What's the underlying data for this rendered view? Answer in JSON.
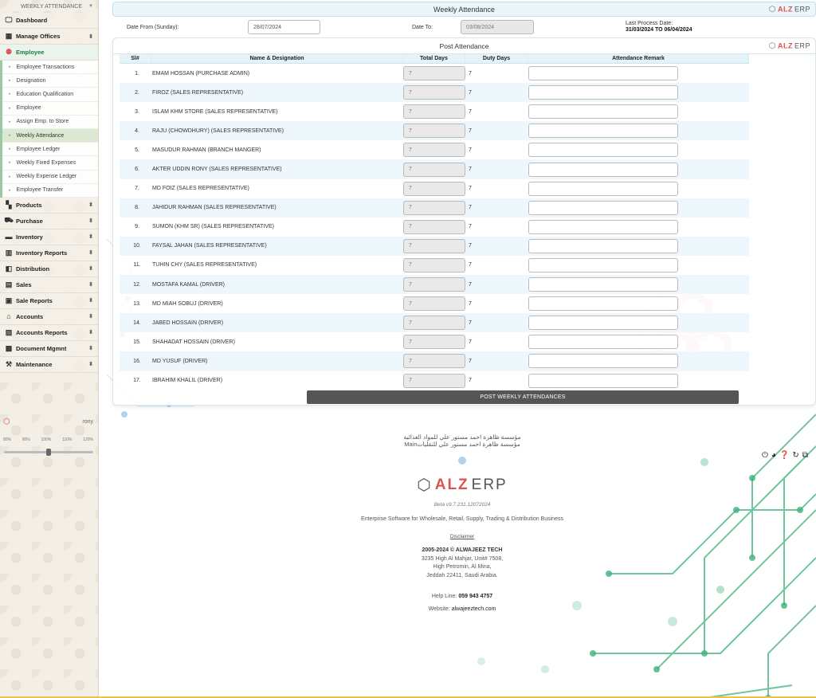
{
  "sidebar": {
    "module_label": "WEEKLY ATTENDANCE",
    "items": [
      {
        "label": "Dashboard",
        "icon": "monitor-icon",
        "glyph": "▭",
        "arrow": ""
      },
      {
        "label": "Manage Offices",
        "icon": "office-icon",
        "glyph": "▦",
        "arrow": "⬍"
      },
      {
        "label": "Employee",
        "icon": "users-icon",
        "glyph": "👥",
        "arrow": ""
      }
    ],
    "employee_sub": [
      "Employee Transactions",
      "Designation",
      "Education Qualification",
      "Employee",
      "Assign Emp. to Store",
      "Weekly Attendance",
      "Employee Ledger",
      "Weekly Fixed Expenses",
      "Weekly Expense Ledger",
      "Employee Transfer"
    ],
    "items_after": [
      {
        "label": "Products",
        "icon": "grid-icon",
        "glyph": "▚"
      },
      {
        "label": "Purchase",
        "icon": "cart-icon",
        "glyph": "⛟"
      },
      {
        "label": "Inventory",
        "icon": "inventory-icon",
        "glyph": "▬"
      },
      {
        "label": "Inventory Reports",
        "icon": "bar-chart-icon",
        "glyph": "▥"
      },
      {
        "label": "Distribution",
        "icon": "book-icon",
        "glyph": "◧"
      },
      {
        "label": "Sales",
        "icon": "sales-icon",
        "glyph": "▤"
      },
      {
        "label": "Sale Reports",
        "icon": "report-icon",
        "glyph": "▣"
      },
      {
        "label": "Accounts",
        "icon": "bank-icon",
        "glyph": "⌂"
      },
      {
        "label": "Accounts Reports",
        "icon": "ledger-icon",
        "glyph": "▨"
      },
      {
        "label": "Document Mgmnt",
        "icon": "document-icon",
        "glyph": "▩"
      },
      {
        "label": "Maintenance",
        "icon": "wrench-icon",
        "glyph": "⚒"
      }
    ],
    "user_name": "rony",
    "zoom_levels": [
      "80%",
      "90%",
      "100%",
      "110%",
      "120%"
    ],
    "zoom_selected": "100%"
  },
  "header": {
    "title": "Weekly Attendance",
    "brand_alz": "ALZ",
    "brand_erp": "ERP"
  },
  "filters": {
    "date_from_label": "Date From (Sunday):",
    "date_from_value": "28/07/2024",
    "date_to_label": "Date To:",
    "date_to_value": "03/08/2024",
    "last_process_label": "Last Process Date:",
    "last_process_value": "31/03/2024 TO 06/04/2024"
  },
  "panel": {
    "title": "Post Attendance",
    "columns": [
      "Sl#",
      "Name & Designation",
      "Total Days",
      "Duty Days",
      "Attendance Remark"
    ],
    "rows": [
      {
        "sl": "1.",
        "name": "EMAM HOSSAN (PURCHASE ADMIN)",
        "total": "7",
        "duty": "7",
        "remark": ""
      },
      {
        "sl": "2.",
        "name": "FIROZ (SALES REPRESENTATIVE)",
        "total": "7",
        "duty": "7",
        "remark": ""
      },
      {
        "sl": "3.",
        "name": "ISLAM KHM STORE (SALES REPRESENTATIVE)",
        "total": "7",
        "duty": "7",
        "remark": ""
      },
      {
        "sl": "4.",
        "name": "RAJU (CHOWDHURY) (SALES REPRESENTATIVE)",
        "total": "7",
        "duty": "7",
        "remark": ""
      },
      {
        "sl": "5.",
        "name": "MASUDUR RAHMAN (BRANCH MANGER)",
        "total": "7",
        "duty": "7",
        "remark": ""
      },
      {
        "sl": "6.",
        "name": "AKTER UDDIN RONY (SALES REPRESENTATIVE)",
        "total": "7",
        "duty": "7",
        "remark": ""
      },
      {
        "sl": "7.",
        "name": "MD FOIZ (SALES REPRESENTATIVE)",
        "total": "7",
        "duty": "7",
        "remark": ""
      },
      {
        "sl": "8.",
        "name": "JAHIDUR RAHMAN (SALES REPRESENTATIVE)",
        "total": "7",
        "duty": "7",
        "remark": ""
      },
      {
        "sl": "9.",
        "name": "SUMON (KHM SR) (SALES REPRESENTATIVE)",
        "total": "7",
        "duty": "7",
        "remark": ""
      },
      {
        "sl": "10.",
        "name": "FAYSAL JAHAN (SALES REPRESENTATIVE)",
        "total": "7",
        "duty": "7",
        "remark": ""
      },
      {
        "sl": "11.",
        "name": "TUHIN CHY (SALES REPRESENTATIVE)",
        "total": "7",
        "duty": "7",
        "remark": ""
      },
      {
        "sl": "12.",
        "name": "MOSTAFA KAMAL (DRIVER)",
        "total": "7",
        "duty": "7",
        "remark": ""
      },
      {
        "sl": "13.",
        "name": "MD MIAH SOBUJ (DRIVER)",
        "total": "7",
        "duty": "7",
        "remark": ""
      },
      {
        "sl": "14.",
        "name": "JABED HOSSAIN (DRIVER)",
        "total": "7",
        "duty": "7",
        "remark": ""
      },
      {
        "sl": "15.",
        "name": "SHAHADAT HOSSAIN (DRIVER)",
        "total": "7",
        "duty": "7",
        "remark": ""
      },
      {
        "sl": "16.",
        "name": "MD YUSUF (DRIVER)",
        "total": "7",
        "duty": "7",
        "remark": ""
      },
      {
        "sl": "17.",
        "name": "IBRAHIM KHALIL (DRIVER)",
        "total": "7",
        "duty": "7",
        "remark": ""
      }
    ],
    "post_button": "POST WEEKLY ATTENDANCES"
  },
  "footer": {
    "arabic_line1": "مؤسسة ظاهرة احمد مستور علي للمواد الغذائية",
    "arabic_line2": "Mainمؤسسة ظاهرة احمد مستور علي للنقليات",
    "logo_alz": "ALZ",
    "logo_erp": "ERP",
    "version": "Beta v9.7.231.12072024",
    "tagline": "Enterprise Software for Wholesale, Retail, Supply, Trading & Distribution Business",
    "disclaimer": "Disclaimer",
    "copyright": "2005-2024 © ALWAJEEZ TECH",
    "address1": "3235 High Al Mahjar, Unit# 7508,",
    "address2": "High Petromin, Al Mina,",
    "address3": "Jeddah 22411, Saudi Arabia.",
    "help_label": "Help Line:",
    "help_value": "059 943 4757",
    "website_label": "Website:",
    "website_value": "alwajeeztech.com"
  },
  "colors": {
    "accent_green": "#1a7a3a",
    "brand_red": "#d9534f",
    "header_bg": "#eaf6fb"
  }
}
